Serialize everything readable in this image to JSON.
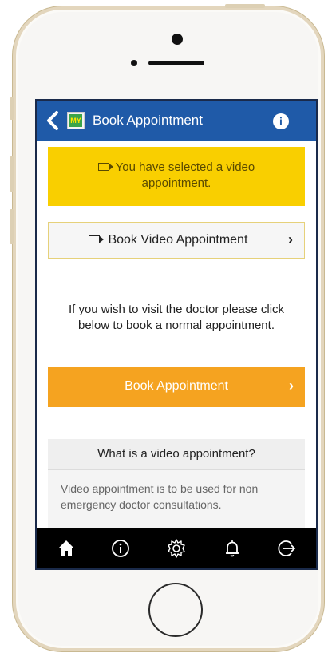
{
  "header": {
    "title": "Book Appointment",
    "logo_text": "MY",
    "info_label": "i"
  },
  "notice": {
    "text": "You have selected a video appointment."
  },
  "video_button": {
    "label": "Book Video Appointment"
  },
  "info_text": "If you wish to visit the doctor please click below to book a normal appointment.",
  "book_button": {
    "label": "Book Appointment"
  },
  "faq": {
    "question": "What is a video appointment?",
    "answer": "Video appointment is to be used for non emergency doctor consultations."
  },
  "tabbar": {
    "items": [
      "home-icon",
      "info-icon",
      "gear-icon",
      "bell-icon",
      "logout-icon"
    ]
  },
  "colors": {
    "header": "#1f5aa8",
    "notice": "#f9cf00",
    "book_button": "#f5a320",
    "tabbar": "#000000"
  }
}
